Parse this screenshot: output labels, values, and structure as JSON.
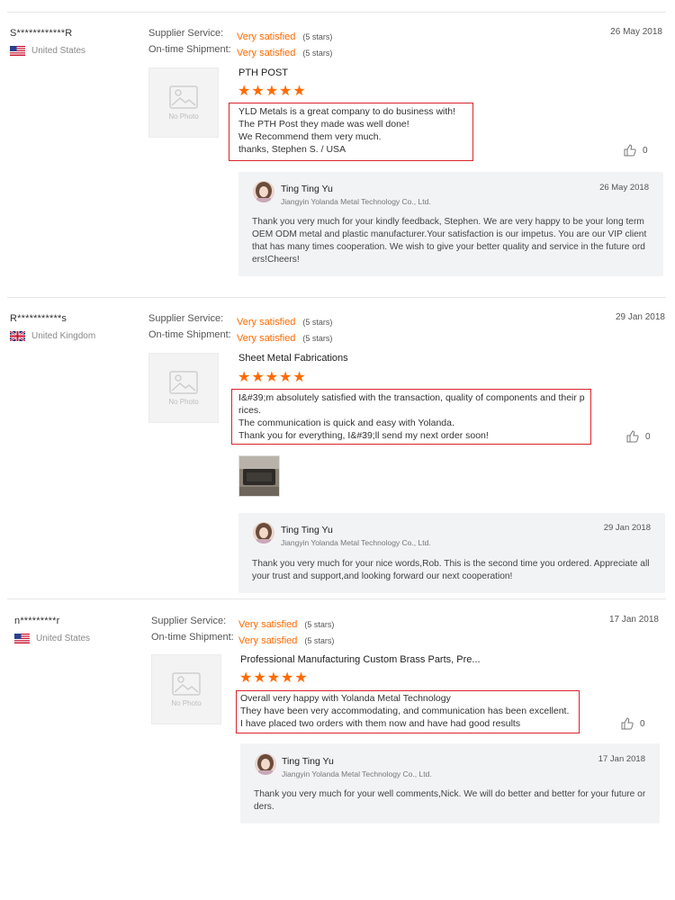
{
  "labels": {
    "supplier_service": "Supplier Service:",
    "ontime_shipment": "On-time Shipment:",
    "no_photo": "No Photo"
  },
  "colors": {
    "accent": "#ff6a00",
    "highlight_box": "#d9242b",
    "reply_bg": "#f2f3f5"
  },
  "reviews": [
    {
      "buyer": "S************R",
      "country": "United States",
      "flag_icon": "us-flag-icon",
      "supplier_service": "Very satisfied",
      "supplier_service_stars": "(5 stars)",
      "ontime_shipment": "Very satisfied",
      "ontime_shipment_stars": "(5 stars)",
      "date": "26 May 2018",
      "product": "PTH POST",
      "rating": 5,
      "comment": "YLD Metals is a great company to do business with!\nThe PTH Post they made was well done!\nWe Recommend them very much.\nthanks, Stephen S. / USA",
      "likes": "0",
      "reply": {
        "name": "Ting Ting Yu",
        "company": "Jiangyin Yolanda Metal Technology Co., Ltd.",
        "date": "26 May 2018",
        "text": "Thank you very much for your kindly feedback, Stephen. We are very happy to be your long term OEM ODM metal and plastic manufacturer.Your satisfaction is our impetus. You are our VIP client that has many times cooperation. We wish to give your better quality and service in the future orders!Cheers!"
      }
    },
    {
      "buyer": "R***********s",
      "country": "United Kingdom",
      "flag_icon": "uk-flag-icon",
      "supplier_service": "Very satisfied",
      "supplier_service_stars": "(5 stars)",
      "ontime_shipment": "Very satisfied",
      "ontime_shipment_stars": "(5 stars)",
      "date": "29 Jan 2018",
      "product": "Sheet Metal Fabrications",
      "rating": 5,
      "comment": "I&#39;m absolutely satisfied with the transaction, quality of components and their prices.\nThe communication is quick and easy with Yolanda.\nThank you for everything, I&#39;ll send my next order soon!",
      "likes": "0",
      "reply": {
        "name": "Ting Ting Yu",
        "company": "Jiangyin Yolanda Metal Technology Co., Ltd.",
        "date": "29 Jan 2018",
        "text": "Thank you very much for your nice words,Rob. This is the second time you ordered. Appreciate all your trust and support,and looking forward our next cooperation!"
      }
    },
    {
      "buyer": "n*********r",
      "country": "United States",
      "flag_icon": "us-flag-icon",
      "supplier_service": "Very satisfied",
      "supplier_service_stars": "(5 stars)",
      "ontime_shipment": "Very satisfied",
      "ontime_shipment_stars": "(5 stars)",
      "date": "17 Jan 2018",
      "product": "Professional Manufacturing Custom Brass Parts, Pre...",
      "rating": 5,
      "comment": "Overall very happy with Yolanda Metal Technology\nThey have been very accommodating, and communication has been excellent.\nI have placed two orders with them now and have had good results",
      "likes": "0",
      "reply": {
        "name": "Ting Ting Yu",
        "company": "Jiangyin Yolanda Metal Technology Co., Ltd.",
        "date": "17 Jan 2018",
        "text": "Thank you very much for your well comments,Nick. We will do better and better for your future orders."
      }
    }
  ]
}
